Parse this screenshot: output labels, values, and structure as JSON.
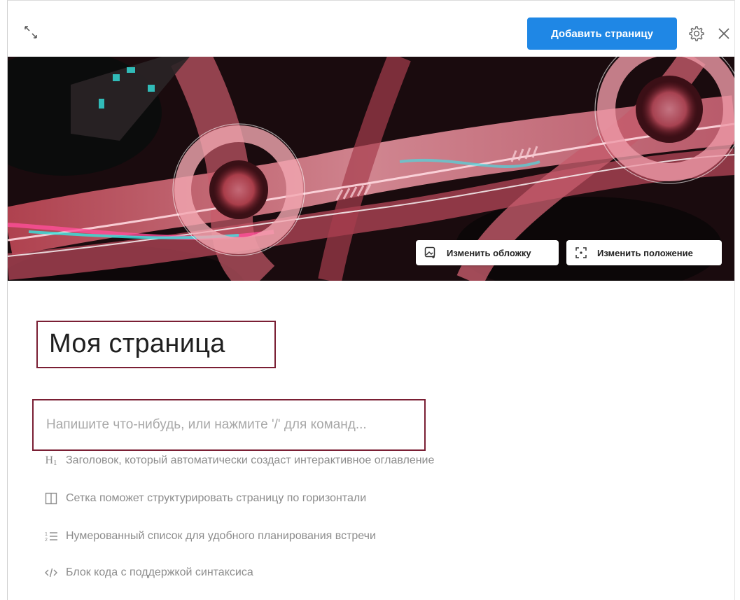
{
  "toolbar": {
    "add_page_label": "Добавить страницу",
    "expand_icon": "expand-arrows-icon",
    "settings_icon": "gear-icon",
    "close_icon": "close-icon",
    "accent_color": "#1f87e5"
  },
  "cover": {
    "change_cover_label": "Изменить обложку",
    "change_position_label": "Изменить положение",
    "change_cover_icon": "image-add-icon",
    "change_position_icon": "reposition-icon"
  },
  "page": {
    "title": "Моя страница",
    "highlight_color": "#7a1f34"
  },
  "editor": {
    "placeholder": "Напишите что-нибудь, или нажмите '/' для команд...",
    "value": ""
  },
  "hints": [
    {
      "icon": "heading-icon",
      "glyph": "H1",
      "label": "Заголовок, который автоматически создаст интерактивное оглавление"
    },
    {
      "icon": "grid-columns-icon",
      "label": "Сетка поможет структурировать страницу по горизонтали"
    },
    {
      "icon": "numbered-list-icon",
      "label": "Нумерованный список для удобного планирования встречи"
    },
    {
      "icon": "code-icon",
      "glyph": "</>",
      "label": "Блок кода с поддержкой синтаксиса"
    }
  ]
}
